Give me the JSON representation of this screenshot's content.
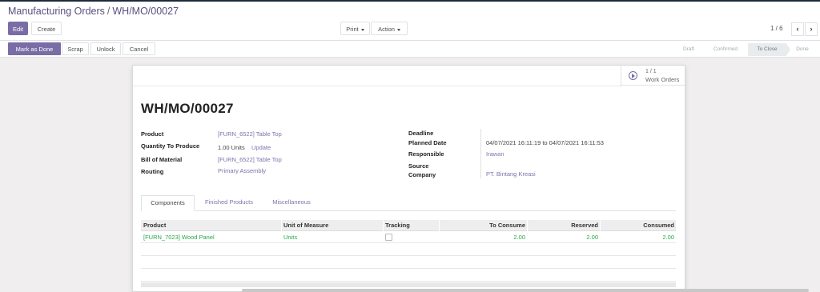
{
  "breadcrumb": {
    "parent": "Manufacturing Orders",
    "separator": "/",
    "current": "WH/MO/00027"
  },
  "toolbar": {
    "edit": "Edit",
    "create": "Create",
    "print": "Print",
    "action": "Action"
  },
  "pager": {
    "value": "1 / 6",
    "prev": "‹",
    "next": "›"
  },
  "statusbar": {
    "buttons": [
      "Mark as Done",
      "Scrap",
      "Unlock",
      "Cancel"
    ],
    "stages": [
      "Draft",
      "Confirmed",
      "To Close",
      "Done"
    ],
    "active_stage": "To Close"
  },
  "smart_button": {
    "count": "1 / 1",
    "label": "Work Orders"
  },
  "record": {
    "title": "WH/MO/00027"
  },
  "fields_left": {
    "product_label": "Product",
    "product_value": "[FURN_6522] Table Top",
    "qty_label": "Quantity To Produce",
    "qty_value": "1.00 Units",
    "qty_update": "Update",
    "bom_label": "Bill of Material",
    "bom_value": "[FURN_6522] Table Top",
    "routing_label": "Routing",
    "routing_value": "Primary Assembly"
  },
  "fields_right": {
    "deadline_label": "Deadline",
    "planned_label": "Planned Date",
    "planned_value": "04/07/2021 16:11:19  to  04/07/2021 16:11:53",
    "responsible_label": "Responsible",
    "responsible_value": "Irawan",
    "source_label": "Source",
    "company_label": "Company",
    "company_value": "PT. Bintang Kreasi"
  },
  "tabs": [
    "Components",
    "Finished Products",
    "Miscellaneous"
  ],
  "table": {
    "headers": [
      "Product",
      "Unit of Measure",
      "Tracking",
      "To Consume",
      "Reserved",
      "Consumed"
    ],
    "rows": [
      {
        "product": "[FURN_7023] Wood Panel",
        "uom": "Units",
        "to_consume": "2.00",
        "reserved": "2.00",
        "consumed": "2.00"
      }
    ]
  },
  "colors": {
    "primary": "#7a6da6",
    "link": "#7c73ad",
    "green": "#28a745"
  }
}
